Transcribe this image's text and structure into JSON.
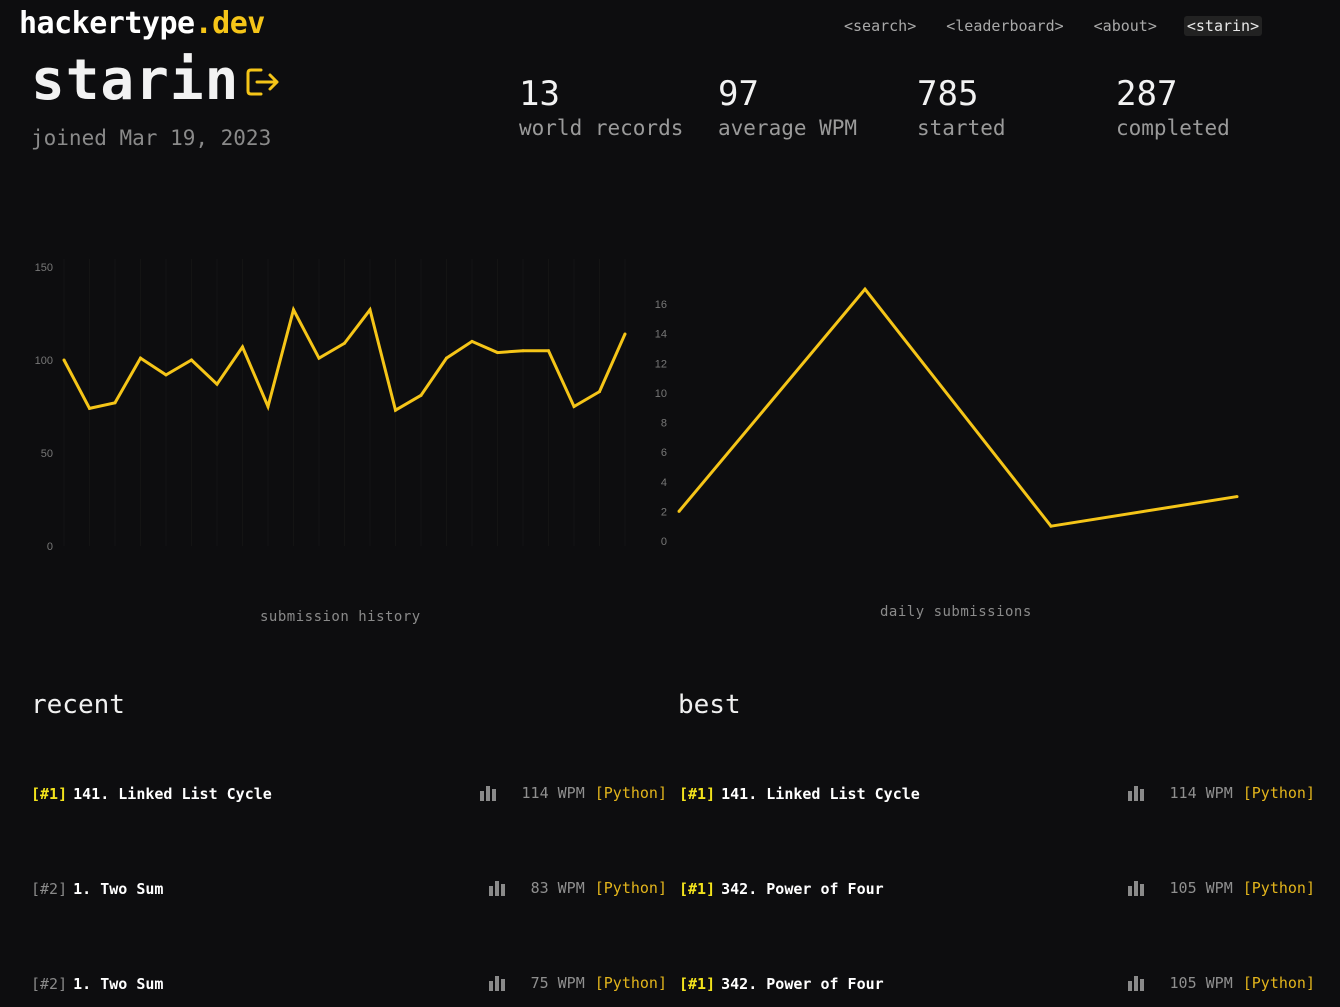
{
  "header": {
    "logo_main": "hackertype",
    "logo_accent": ".dev",
    "nav": [
      "<search>",
      "<leaderboard>",
      "<about>",
      "<starin>"
    ]
  },
  "profile": {
    "username": "starin",
    "joined": "joined Mar 19, 2023"
  },
  "stats": [
    {
      "value": "13",
      "label": "world records"
    },
    {
      "value": "97",
      "label": "average WPM"
    },
    {
      "value": "785",
      "label": "started"
    },
    {
      "value": "287",
      "label": "completed"
    }
  ],
  "colors": {
    "accent": "#f5c518",
    "line": "#f5c518",
    "rank_top": "#f2e21c",
    "lang": "#e3b51c"
  },
  "chart_data": [
    {
      "type": "line",
      "title": "submission history",
      "xlabel": "",
      "ylabel": "",
      "ylim": [
        0,
        150
      ],
      "yticks": [
        0,
        50,
        100,
        150
      ],
      "x": [
        1,
        2,
        3,
        4,
        5,
        6,
        7,
        8,
        9,
        10,
        11,
        12,
        13,
        14,
        15,
        16,
        17,
        18,
        19,
        20,
        21,
        22,
        23
      ],
      "values": [
        100,
        74,
        77,
        101,
        92,
        100,
        87,
        107,
        75,
        127,
        101,
        109,
        127,
        73,
        81,
        101,
        110,
        104,
        105,
        105,
        75,
        83,
        114
      ],
      "grid": true
    },
    {
      "type": "line",
      "title": "daily submissions",
      "xlabel": "",
      "ylabel": "",
      "ylim": [
        0,
        16
      ],
      "yticks": [
        0,
        2,
        4,
        6,
        8,
        10,
        12,
        14,
        16
      ],
      "x": [
        1,
        2,
        3,
        4
      ],
      "values": [
        2,
        17,
        1,
        3
      ],
      "grid": false
    }
  ],
  "recent": {
    "title": "recent",
    "items": [
      {
        "rank": "[#1]",
        "problem": "141. Linked List Cycle",
        "wpm": "114 WPM",
        "lang": "[Python]",
        "top": true
      },
      {
        "rank": "[#2]",
        "problem": "1. Two Sum",
        "wpm": "83 WPM",
        "lang": "[Python]",
        "top": false
      },
      {
        "rank": "[#2]",
        "problem": "1. Two Sum",
        "wpm": "75 WPM",
        "lang": "[Python]",
        "top": false
      }
    ]
  },
  "best": {
    "title": "best",
    "items": [
      {
        "rank": "[#1]",
        "problem": "141. Linked List Cycle",
        "wpm": "114 WPM",
        "lang": "[Python]",
        "top": true
      },
      {
        "rank": "[#1]",
        "problem": "342. Power of Four",
        "wpm": "105 WPM",
        "lang": "[Python]",
        "top": true
      },
      {
        "rank": "[#1]",
        "problem": "342. Power of Four",
        "wpm": "105 WPM",
        "lang": "[Python]",
        "top": true
      }
    ]
  }
}
